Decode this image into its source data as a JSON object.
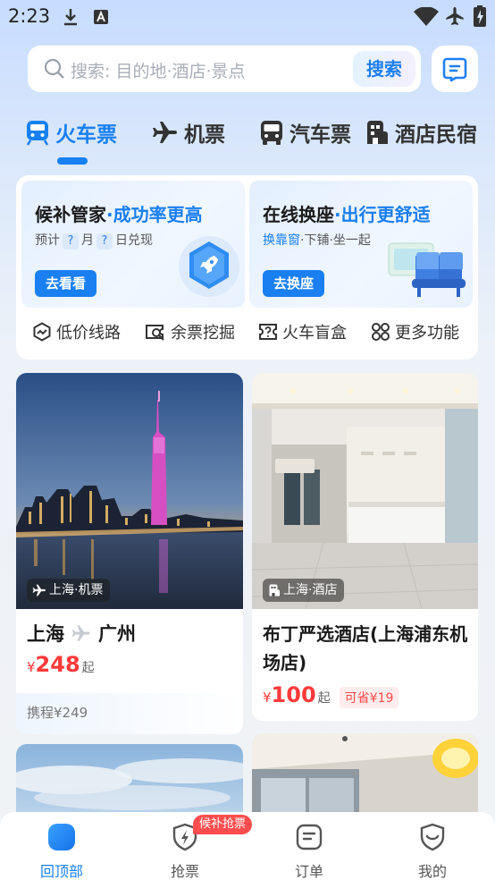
{
  "status_bar": {
    "time": "2:23"
  },
  "search": {
    "placeholder": "搜索: 目的地·酒店·景点",
    "button_label": "搜索"
  },
  "tabs": [
    {
      "label": "火车票",
      "icon": "train-icon",
      "active": true
    },
    {
      "label": "机票",
      "icon": "plane-icon",
      "active": false
    },
    {
      "label": "汽车票",
      "icon": "bus-icon",
      "active": false
    },
    {
      "label": "酒店民宿",
      "icon": "hotel-icon",
      "active": false
    }
  ],
  "promos": [
    {
      "title_main": "候补管家",
      "title_highlight": "·成功率更高",
      "sub_parts": [
        "预计",
        "?",
        "月",
        "?",
        "日兑现"
      ],
      "button": "去看看"
    },
    {
      "title_main": "在线换座",
      "title_highlight": "·出行更舒适",
      "sub_first": "换靠窗",
      "sub_rest": "·下铺·坐一起",
      "button": "去换座"
    }
  ],
  "quick_links": [
    {
      "label": "低价线路",
      "icon": "low-price-route-icon"
    },
    {
      "label": "余票挖掘",
      "icon": "ticket-search-icon"
    },
    {
      "label": "火车盲盒",
      "icon": "mystery-box-icon"
    },
    {
      "label": "更多功能",
      "icon": "more-grid-icon"
    }
  ],
  "cards": [
    {
      "tag": "上海·机票",
      "from": "上海",
      "to": "广州",
      "price_yen": "¥",
      "price": "248",
      "price_suffix": "起",
      "ref_price": "携程¥249"
    },
    {
      "tag": "上海·酒店",
      "title": "布丁严选酒店(上海浦东机场店)",
      "price_yen": "¥",
      "price": "100",
      "price_suffix": "起",
      "saving": "可省¥19"
    }
  ],
  "bottom_nav": [
    {
      "label": "回顶部",
      "active": true
    },
    {
      "label": "抢票",
      "active": false,
      "badge": "候补抢票"
    },
    {
      "label": "订单",
      "active": false
    },
    {
      "label": "我的",
      "active": false
    }
  ],
  "colors": {
    "accent": "#1880f0",
    "price": "#ff3a3a",
    "badge": "#ff4d4f"
  }
}
